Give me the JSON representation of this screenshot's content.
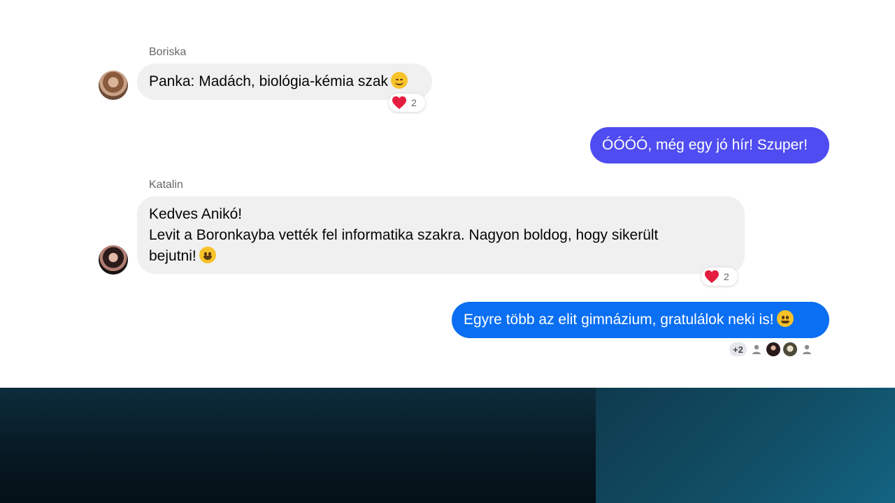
{
  "messages": [
    {
      "sender": "Boriska",
      "direction": "incoming",
      "lines": [
        "Panka: Madách, biológia-kémia szak"
      ],
      "emoji": "relieved-face-icon",
      "reaction": {
        "icon": "heart-icon",
        "count": "2"
      }
    },
    {
      "direction": "outgoing",
      "lines": [
        "ÓÓÓÓ, még egy jó hír! Szuper!"
      ],
      "color": "#4f4cf1"
    },
    {
      "sender": "Katalin",
      "direction": "incoming",
      "lines": [
        "Kedves Anikó!",
        "Levit a Boronkayba vették fel informatika szakra. Nagyon boldog, hogy sikerült",
        "bejutni!"
      ],
      "emoji": "grinning-face-icon",
      "reaction": {
        "icon": "heart-icon",
        "count": "2"
      }
    },
    {
      "direction": "outgoing",
      "lines": [
        "Egyre több az elit gimnázium, gratulálok neki is!"
      ],
      "emoji": "slightly-smiling-face-icon",
      "color": "#0a6ff2",
      "seen_by": {
        "more": "+2",
        "avatars": [
          "default-avatar-icon",
          "user-photo",
          "user-photo",
          "default-avatar-icon"
        ]
      }
    }
  ],
  "colors": {
    "incoming_bubble": "#f0f0f0",
    "heart": "#e41e3f",
    "bottom_band_left": "#071822",
    "bottom_band_right": "#115067"
  }
}
